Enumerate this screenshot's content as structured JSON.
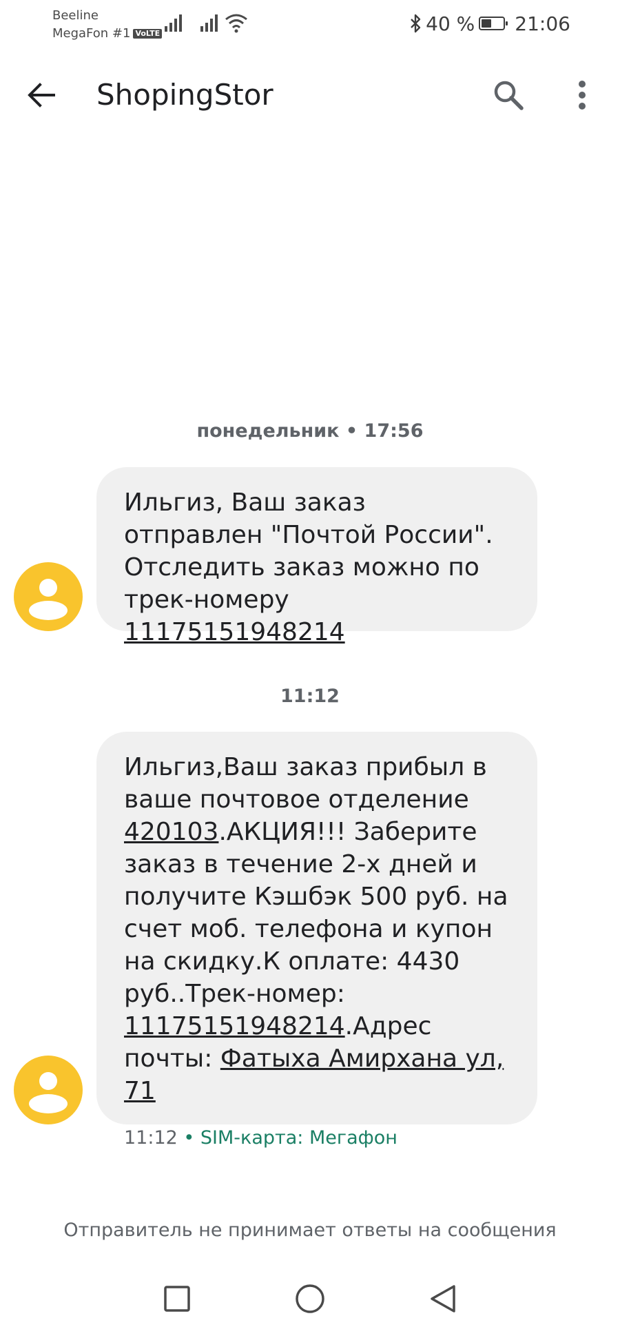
{
  "status_bar": {
    "carrier_1": "Beeline",
    "carrier_2": "MegaFon #1",
    "volte": "VoLTE",
    "battery": "40 %",
    "time": "21:06"
  },
  "app_bar": {
    "title": "ShopingStor",
    "back_icon": "arrow-back-icon",
    "search_icon": "search-icon",
    "menu_icon": "more-vert-icon"
  },
  "messages": [
    {
      "timestamp": "понедельник • 17:56",
      "text_1": "Ильгиз, Ваш заказ отправлен \"Почтой России\". Отследить заказ можно по трек-номеру ",
      "track_link": "11175151948214"
    },
    {
      "timestamp": "11:12",
      "line_1": "Ильгиз,Ваш заказ прибыл в ваше почтовое отделение ",
      "postcode_link": "420103",
      "line_2": ".АКЦИЯ!!! Заберите заказ в течение 2-х дней и получите Кэшбэк 500 руб. на счет моб. телефона и купон на скидку.К оплате: 4430 руб..Трек-номер: ",
      "track_link": "11175151948214",
      "line_3": ".Адрес почты: ",
      "address_link": "Фатыха Амирхана ул, 71",
      "meta_time": "11:12",
      "meta_sim": " • SIM-карта: Мегафон"
    }
  ],
  "footer": {
    "notice": "Отправитель не принимает ответы на сообщения"
  },
  "colors": {
    "avatar": "#f9c42d",
    "bubble": "#f0f0f0",
    "sim_label": "#1a7f64"
  }
}
